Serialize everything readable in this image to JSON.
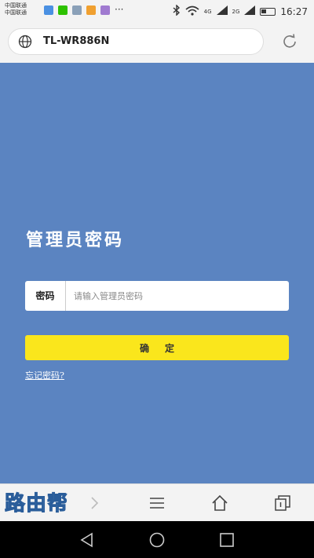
{
  "status_bar": {
    "carrier_line1": "中国联通",
    "carrier_line2": "中国联通",
    "more": "···",
    "network_4g": "4G",
    "network_2g": "2G",
    "time": "16:27"
  },
  "browser": {
    "url": "TL-WR886N"
  },
  "login": {
    "title": "管理员密码",
    "password_label": "密码",
    "password_placeholder": "请输入管理员密码",
    "password_value": "",
    "confirm_label": "确定",
    "forgot_link": "忘记密码?"
  },
  "watermark": "路由帮",
  "colors": {
    "page_bg": "#5b84c1",
    "confirm_bg": "#fae61c",
    "bar_bg": "#f3f3f3"
  },
  "icons": {
    "address": "globe-icon",
    "reload": "reload-icon",
    "back": "chevron-left-icon",
    "forward": "chevron-right-icon",
    "menu": "menu-icon",
    "home": "home-icon",
    "tabs": "tabs-icon",
    "nav_back": "nav-back-icon",
    "nav_home": "nav-home-icon",
    "nav_recent": "nav-recent-icon"
  }
}
